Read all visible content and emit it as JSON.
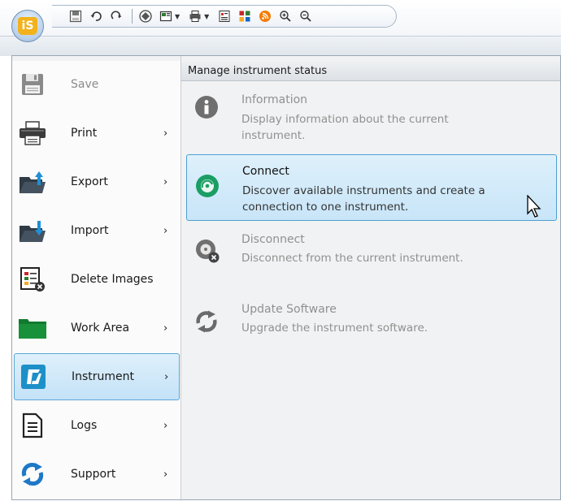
{
  "app": {
    "logo_text": "iS"
  },
  "toolbar_icons": [
    "save-icon",
    "undo-icon",
    "redo-icon",
    "sample-icon",
    "view-icon",
    "print-icon",
    "report-icon",
    "grid-icon",
    "rss-icon",
    "zoom-in-icon",
    "zoom-out-icon"
  ],
  "menu": {
    "items": [
      {
        "label": "Save",
        "icon": "floppy-disk-icon",
        "enabled": false,
        "submenu": false
      },
      {
        "label": "Print",
        "icon": "printer-icon",
        "enabled": true,
        "submenu": true
      },
      {
        "label": "Export",
        "icon": "export-folder-icon",
        "enabled": true,
        "submenu": true
      },
      {
        "label": "Import",
        "icon": "import-folder-icon",
        "enabled": true,
        "submenu": true
      },
      {
        "label": "Delete Images",
        "icon": "delete-images-icon",
        "enabled": true,
        "submenu": false
      },
      {
        "label": "Work Area",
        "icon": "green-folder-icon",
        "enabled": true,
        "submenu": true
      },
      {
        "label": "Instrument",
        "icon": "instrument-icon",
        "enabled": true,
        "submenu": true,
        "selected": true
      },
      {
        "label": "Logs",
        "icon": "document-icon",
        "enabled": true,
        "submenu": true
      },
      {
        "label": "Support",
        "icon": "support-icon",
        "enabled": true,
        "submenu": true
      }
    ],
    "submenu_arrow": "›"
  },
  "panel": {
    "header": "Manage instrument status",
    "items": [
      {
        "title": "Information",
        "desc_line1": "Display information about the current",
        "desc_line2": "instrument.",
        "enabled": false
      },
      {
        "title": "Connect",
        "desc_line1": "Discover available instruments and create a",
        "desc_line2": "connection to one instrument.",
        "enabled": true,
        "highlighted": true
      },
      {
        "title": "Disconnect",
        "desc_line1": "Disconnect from the current instrument.",
        "desc_line2": "",
        "enabled": false
      },
      {
        "title": "Update Software",
        "desc_line1": "Upgrade the instrument software.",
        "desc_line2": "",
        "enabled": false
      }
    ]
  },
  "colors": {
    "accent": "#1e90c8",
    "selection_border": "#5aa5d6",
    "connect_green": "#1a9e64",
    "logo_orange": "#f2b21b"
  }
}
